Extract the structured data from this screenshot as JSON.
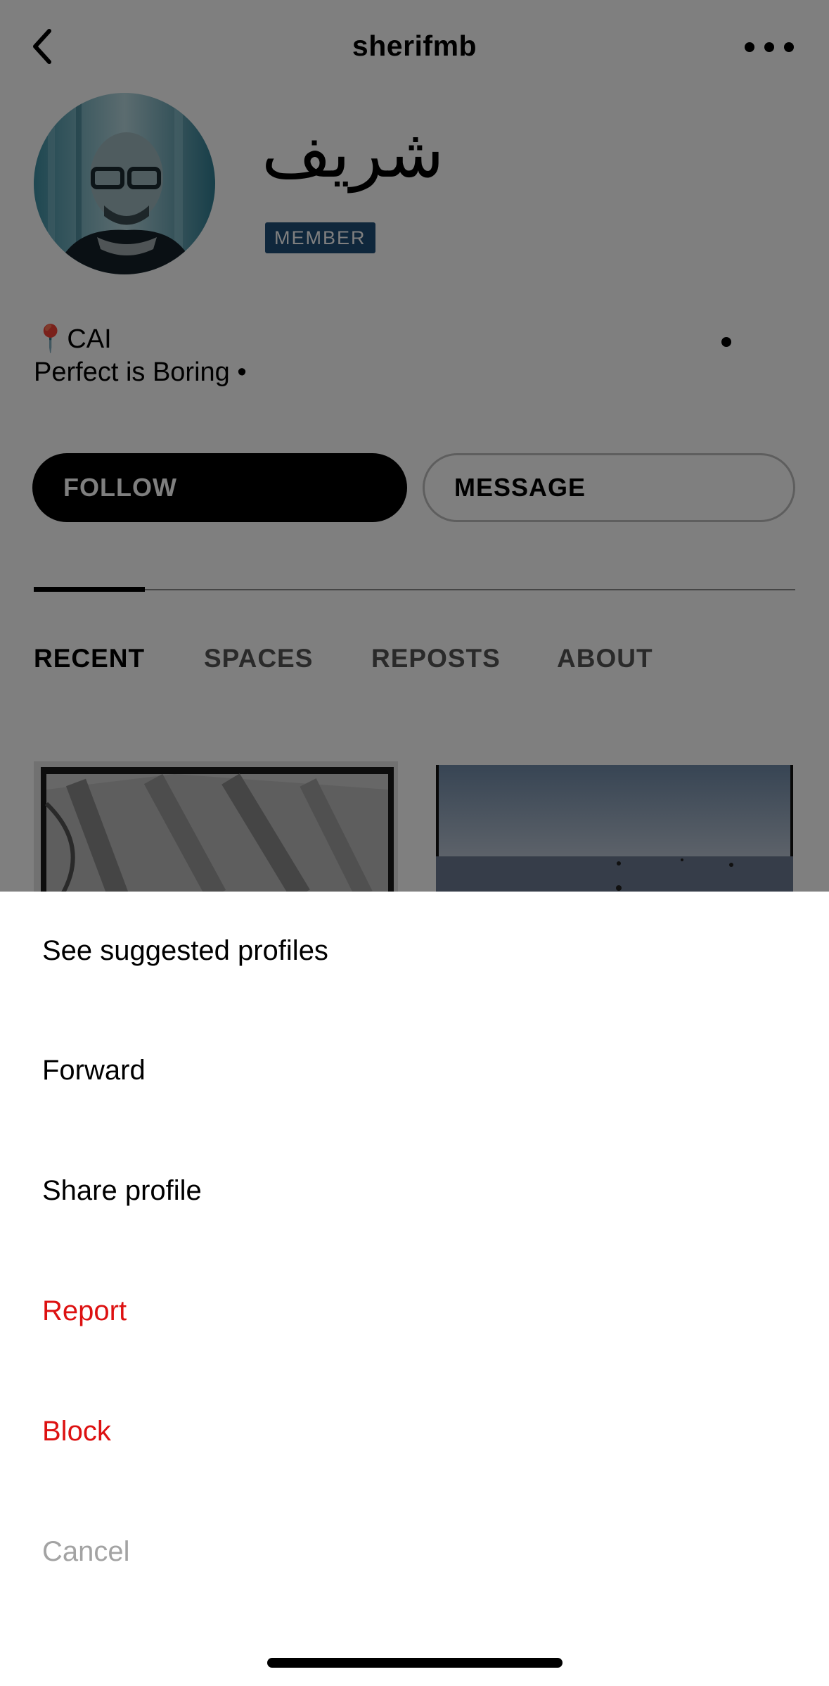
{
  "header": {
    "title": "sherifmb",
    "back_icon": "chevron-left-icon",
    "more_icon": "ellipsis-icon"
  },
  "profile": {
    "display_name": "شريف",
    "badge": "MEMBER",
    "location_icon": "pin-icon",
    "location_pin_glyph": "📍",
    "location": "CAI",
    "tagline": "Perfect is Boring •",
    "badge_color": "#1f4e79"
  },
  "actions": {
    "follow": "FOLLOW",
    "message": "MESSAGE"
  },
  "tabs": [
    {
      "label": "RECENT",
      "active": true
    },
    {
      "label": "SPACES",
      "active": false
    },
    {
      "label": "REPOSTS",
      "active": false
    },
    {
      "label": "ABOUT",
      "active": false
    }
  ],
  "sheet": {
    "items": [
      {
        "label": "See suggested profiles",
        "style": "normal"
      },
      {
        "label": "Forward",
        "style": "normal"
      },
      {
        "label": "Share profile",
        "style": "normal"
      },
      {
        "label": "Report",
        "style": "danger"
      },
      {
        "label": "Block",
        "style": "danger"
      },
      {
        "label": "Cancel",
        "style": "muted"
      }
    ],
    "danger_color": "#dd1111",
    "muted_color": "#a3a3a3"
  }
}
